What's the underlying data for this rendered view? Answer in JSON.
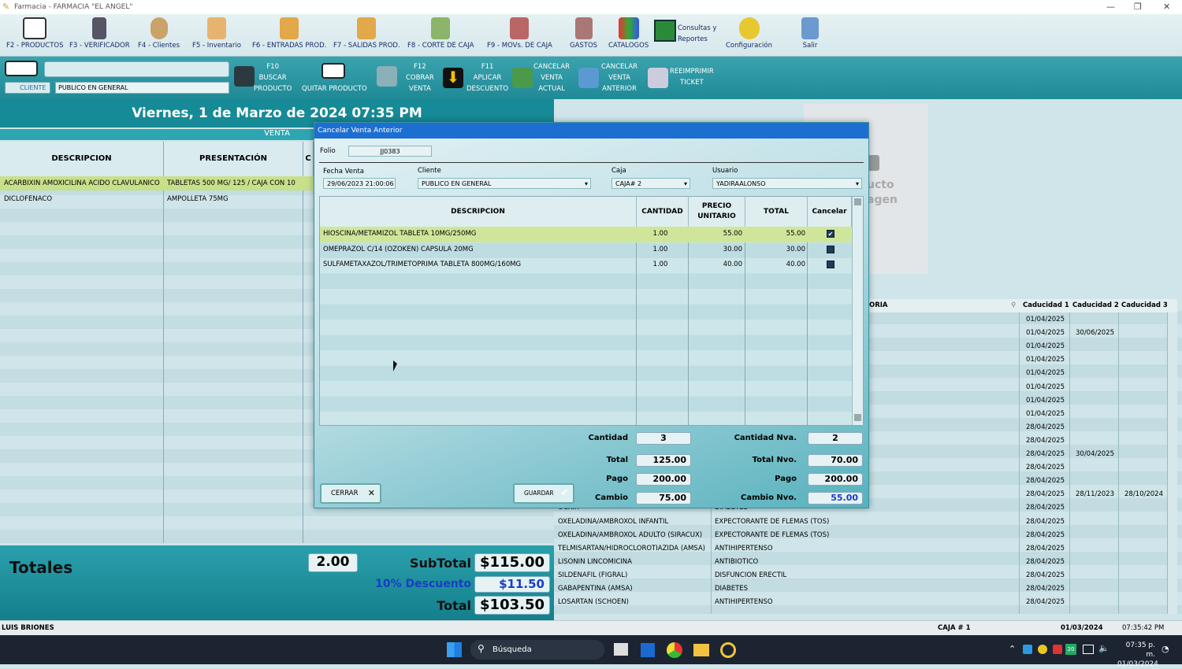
{
  "window": {
    "title": "Farmacia  -  FARMACIA \"EL ANGEL\""
  },
  "ribbon": [
    {
      "label": "F2 - PRODUCTOS",
      "icon": "barcode-icon"
    },
    {
      "label": "F3 - VERIFICADOR",
      "icon": "scanner-icon"
    },
    {
      "label": "F4 - Clientes",
      "icon": "customers-icon"
    },
    {
      "label": "F5 - Inventario",
      "icon": "inventory-icon"
    },
    {
      "label": "F6 - ENTRADAS PROD.",
      "icon": "box-in-icon"
    },
    {
      "label": "F7 - SALIDAS PROD.",
      "icon": "box-out-icon"
    },
    {
      "label": "F8 - CORTE DE CAJA",
      "icon": "cash-register-icon"
    },
    {
      "label": "F9 - MOVs. DE CAJA",
      "icon": "cash-movements-icon"
    },
    {
      "label": "GASTOS",
      "icon": "expenses-icon"
    },
    {
      "label": "CATALOGOS",
      "icon": "catalog-icon"
    },
    {
      "label": "Consultas y",
      "label2": "Reportes",
      "icon": "chart-icon"
    },
    {
      "label": "Configuración",
      "icon": "gear-icon"
    },
    {
      "label": "Salir",
      "icon": "exit-icon"
    }
  ],
  "toolbar2": {
    "cliente_btn": "CLIENTE",
    "cliente_name": "PUBLICO EN GENERAL",
    "buscar": [
      "F10",
      "BUSCAR",
      "PRODUCTO"
    ],
    "quitar": "QUITAR PRODUCTO",
    "cobrar": [
      "F12",
      "COBRAR",
      "VENTA"
    ],
    "aplicar": [
      "F11",
      "APLICAR",
      "DESCUENTO"
    ],
    "cancelar_actual": [
      "CANCELAR",
      "VENTA",
      "ACTUAL"
    ],
    "cancelar_anterior": [
      "CANCELAR",
      "VENTA",
      "ANTERIOR"
    ],
    "reimprimir": [
      "REEIMPRIMIR",
      "TICKET"
    ]
  },
  "left": {
    "date": "Viernes, 1 de Marzo de 2024  07:35 PM",
    "venta_label": "VENTA",
    "headers": [
      "DESCRIPCION",
      "PRESENTACIÓN",
      "C"
    ],
    "rows": [
      {
        "desc": "ACARBIXIN AMOXICILINA  ACIDO CLAVULANICO",
        "pres": "TABLETAS 500 MG/ 125 / CAJA CON 10"
      },
      {
        "desc": "DICLOFENACO",
        "pres": "AMPOLLETA 75MG"
      }
    ]
  },
  "totals": {
    "label": "Totales",
    "count": "2.00",
    "subtotal_label": "SubTotal",
    "subtotal": "$115.00",
    "descuento_label": "10% Descuento",
    "descuento": "$11.50",
    "total_label": "Total",
    "total": "$103.50"
  },
  "right": {
    "image_text": [
      "ucto",
      "agen"
    ],
    "headers": [
      "ORIA",
      "Caducidad 1",
      "Caducidad 2",
      "Caducidad 3"
    ],
    "rows": [
      {
        "name": "",
        "cat": "",
        "c1": "01/04/2025",
        "c2": "",
        "c3": ""
      },
      {
        "name": "",
        "cat": "",
        "c1": "01/04/2025",
        "c2": "30/06/2025",
        "c3": ""
      },
      {
        "name": "",
        "cat": "",
        "c1": "01/04/2025",
        "c2": "",
        "c3": ""
      },
      {
        "name": "",
        "cat": "",
        "c1": "01/04/2025",
        "c2": "",
        "c3": ""
      },
      {
        "name": "",
        "cat": "",
        "c1": "01/04/2025",
        "c2": "",
        "c3": ""
      },
      {
        "name": "",
        "cat": "",
        "c1": "01/04/2025",
        "c2": "",
        "c3": ""
      },
      {
        "name": "",
        "cat": "",
        "c1": "01/04/2025",
        "c2": "",
        "c3": ""
      },
      {
        "name": "",
        "cat": "",
        "c1": "01/04/2025",
        "c2": "",
        "c3": ""
      },
      {
        "name": "",
        "cat": "",
        "c1": "28/04/2025",
        "c2": "",
        "c3": ""
      },
      {
        "name": "",
        "cat": "",
        "c1": "28/04/2025",
        "c2": "",
        "c3": ""
      },
      {
        "name": "",
        "cat": "",
        "c1": "28/04/2025",
        "c2": "30/04/2025",
        "c3": ""
      },
      {
        "name": "",
        "cat": "",
        "c1": "28/04/2025",
        "c2": "",
        "c3": ""
      },
      {
        "name": "",
        "cat": "",
        "c1": "28/04/2025",
        "c2": "",
        "c3": ""
      },
      {
        "name": "",
        "cat": "",
        "c1": "28/04/2025",
        "c2": "28/11/2023",
        "c3": "28/10/2024"
      },
      {
        "name": "OCRIX",
        "cat": "DIABETES",
        "c1": "28/04/2025",
        "c2": "",
        "c3": ""
      },
      {
        "name": "OXELADINA/AMBROXOL INFANTIL",
        "cat": "EXPECTORANTE DE FLEMAS (TOS)",
        "c1": "28/04/2025",
        "c2": "",
        "c3": ""
      },
      {
        "name": "OXELADINA/AMBROXOL ADULTO (SIRACUX)",
        "cat": "EXPECTORANTE DE FLEMAS (TOS)",
        "c1": "28/04/2025",
        "c2": "",
        "c3": ""
      },
      {
        "name": "TELMISARTAN/HIDROCLOROTIAZIDA (AMSA)",
        "cat": "ANTIHIPERTENSO",
        "c1": "28/04/2025",
        "c2": "",
        "c3": ""
      },
      {
        "name": "LISONIN LINCOMICINA",
        "cat": "ANTIBIOTICO",
        "c1": "28/04/2025",
        "c2": "",
        "c3": ""
      },
      {
        "name": "SILDENAFIL (FIGRAL)",
        "cat": "DISFUNCION ERECTIL",
        "c1": "28/04/2025",
        "c2": "",
        "c3": ""
      },
      {
        "name": "GABAPENTINA (AMSA)",
        "cat": "DIABETES",
        "c1": "28/04/2025",
        "c2": "",
        "c3": ""
      },
      {
        "name": "LOSARTAN (SCHOEN)",
        "cat": "ANTIHIPERTENSO",
        "c1": "28/04/2025",
        "c2": "",
        "c3": ""
      }
    ]
  },
  "status": {
    "user": "LUIS BRIONES",
    "caja": "CAJA # 1",
    "date": "01/03/2024",
    "time": "07:35:42 PM"
  },
  "taskbar": {
    "search": "Búsqueda",
    "time": "07:35 p. m.",
    "date": "01/03/2024",
    "badge": "20"
  },
  "dialog": {
    "title": "Cancelar Venta Anterior",
    "folio_label": "Folio",
    "folio": "JJ0383",
    "fecha_label": "Fecha Venta",
    "fecha": "29/06/2023 21:00:06",
    "cliente_label": "Cliente",
    "cliente": "PUBLICO EN GENERAL",
    "caja_label": "Caja",
    "caja": "CAJA# 2",
    "usuario_label": "Usuario",
    "usuario": "YADIRAALONSO",
    "headers": {
      "desc": "DESCRIPCION",
      "cant": "CANTIDAD",
      "precio1": "PRECIO",
      "precio2": "UNITARIO",
      "total": "TOTAL",
      "cancel": "Cancelar"
    },
    "rows": [
      {
        "desc": "HIOSCINA/METAMIZOL TABLETA 10MG/250MG",
        "cant": "1.00",
        "precio": "55.00",
        "total": "55.00",
        "checked": "✔"
      },
      {
        "desc": "OMEPRAZOL C/14 (OZOKEN) CAPSULA 20MG",
        "cant": "1.00",
        "precio": "30.00",
        "total": "30.00",
        "checked": ""
      },
      {
        "desc": "SULFAMETAXAZOL/TRIMETOPRIMA TABLETA 800MG/160MG",
        "cant": "1.00",
        "precio": "40.00",
        "total": "40.00",
        "checked": ""
      }
    ],
    "summary": {
      "cantidad_label": "Cantidad",
      "cantidad": "3",
      "cantidad_nva_label": "Cantidad Nva.",
      "cantidad_nva": "2",
      "total_label": "Total",
      "total": "125.00",
      "total_nvo_label": "Total Nvo.",
      "total_nvo": "70.00",
      "pago_label": "Pago",
      "pago": "200.00",
      "pago_nvo_label": "Pago",
      "pago_nvo": "200.00",
      "cambio_label": "Cambio",
      "cambio": "75.00",
      "cambio_nvo_label": "Cambio Nvo.",
      "cambio_nvo": "55.00"
    },
    "cerrar": "CERRAR",
    "guardar": "GUARDAR"
  },
  "colors": {
    "accent": "#168a96",
    "dialog_title": "#1c6fd1",
    "blue_text": "#1a3cc8"
  }
}
